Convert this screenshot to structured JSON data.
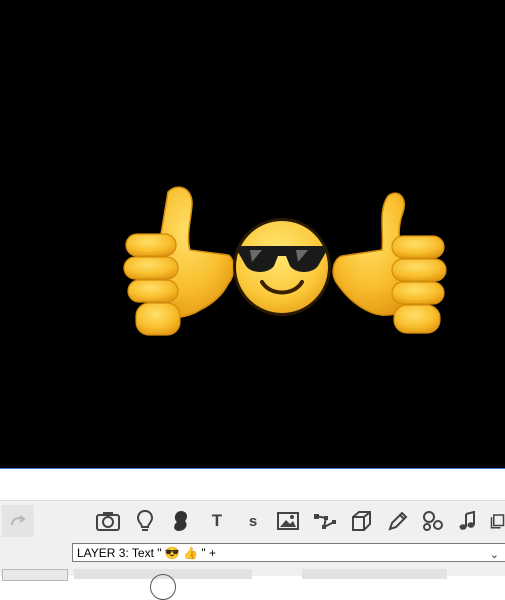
{
  "canvas": {
    "background": "#000000",
    "content": [
      "thumbs-up-hand-left",
      "smiling-face-with-sunglasses",
      "thumbs-up-hand-right"
    ]
  },
  "toolbar": {
    "tools": [
      {
        "name": "redo",
        "icon": "redo-icon",
        "enabled": false
      },
      {
        "name": "camera",
        "icon": "camera-icon"
      },
      {
        "name": "light",
        "icon": "lightbulb-icon"
      },
      {
        "name": "paint",
        "icon": "brush-blob-icon"
      },
      {
        "name": "text",
        "icon": "text-icon",
        "glyph": "T"
      },
      {
        "name": "subtitle",
        "icon": "s-icon",
        "glyph": "s"
      },
      {
        "name": "image",
        "icon": "image-icon"
      },
      {
        "name": "path",
        "icon": "vector-path-icon"
      },
      {
        "name": "3d",
        "icon": "cube-icon"
      },
      {
        "name": "draw",
        "icon": "pencil-icon"
      },
      {
        "name": "particles",
        "icon": "particles-icon"
      },
      {
        "name": "audio",
        "icon": "music-note-icon"
      },
      {
        "name": "more",
        "icon": "copy-icon"
      }
    ]
  },
  "layer": {
    "selected": "LAYER 3: Text \" 😎 👍 \" +",
    "colors": {
      "border": "#7a7a7a",
      "bg": "#ffffff"
    }
  }
}
